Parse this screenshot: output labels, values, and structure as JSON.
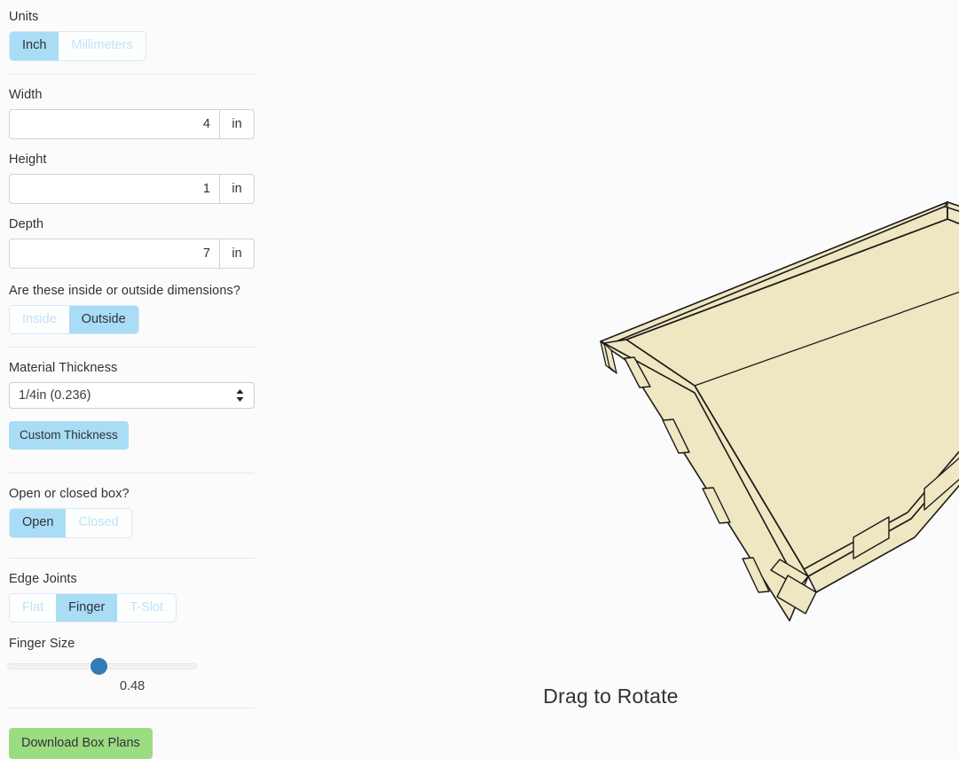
{
  "sidebar": {
    "units": {
      "label": "Units",
      "options": [
        "Inch",
        "Millimeters"
      ],
      "selected": "Inch"
    },
    "width": {
      "label": "Width",
      "value": "4",
      "unit_suffix": "in"
    },
    "height": {
      "label": "Height",
      "value": "1",
      "unit_suffix": "in"
    },
    "depth": {
      "label": "Depth",
      "value": "7",
      "unit_suffix": "in"
    },
    "dimension_basis": {
      "label": "Are these inside or outside dimensions?",
      "options": [
        "Inside",
        "Outside"
      ],
      "selected": "Outside"
    },
    "material_thickness": {
      "label": "Material Thickness",
      "selected": "1/4in (0.236)",
      "custom_button": "Custom Thickness"
    },
    "box_type": {
      "label": "Open or closed box?",
      "options": [
        "Open",
        "Closed"
      ],
      "selected": "Open"
    },
    "edge_joints": {
      "label": "Edge Joints",
      "options": [
        "Flat",
        "Finger",
        "T-Slot"
      ],
      "selected": "Finger"
    },
    "finger_size": {
      "label": "Finger Size",
      "value": "0.48",
      "percent": 48
    },
    "download_button": "Download Box Plans"
  },
  "viewer": {
    "hint": "Drag to Rotate",
    "box_face_color": "#efe6c2",
    "box_edge_color": "#1a1a1a",
    "background_color": "#fbfbfb"
  },
  "theme": {
    "accent_blue": "#a9dcf5",
    "accent_green": "#9cdc81",
    "slider_blue": "#2f7cb6",
    "text": "#2e3338",
    "muted_blue": "#bfe3f7"
  }
}
